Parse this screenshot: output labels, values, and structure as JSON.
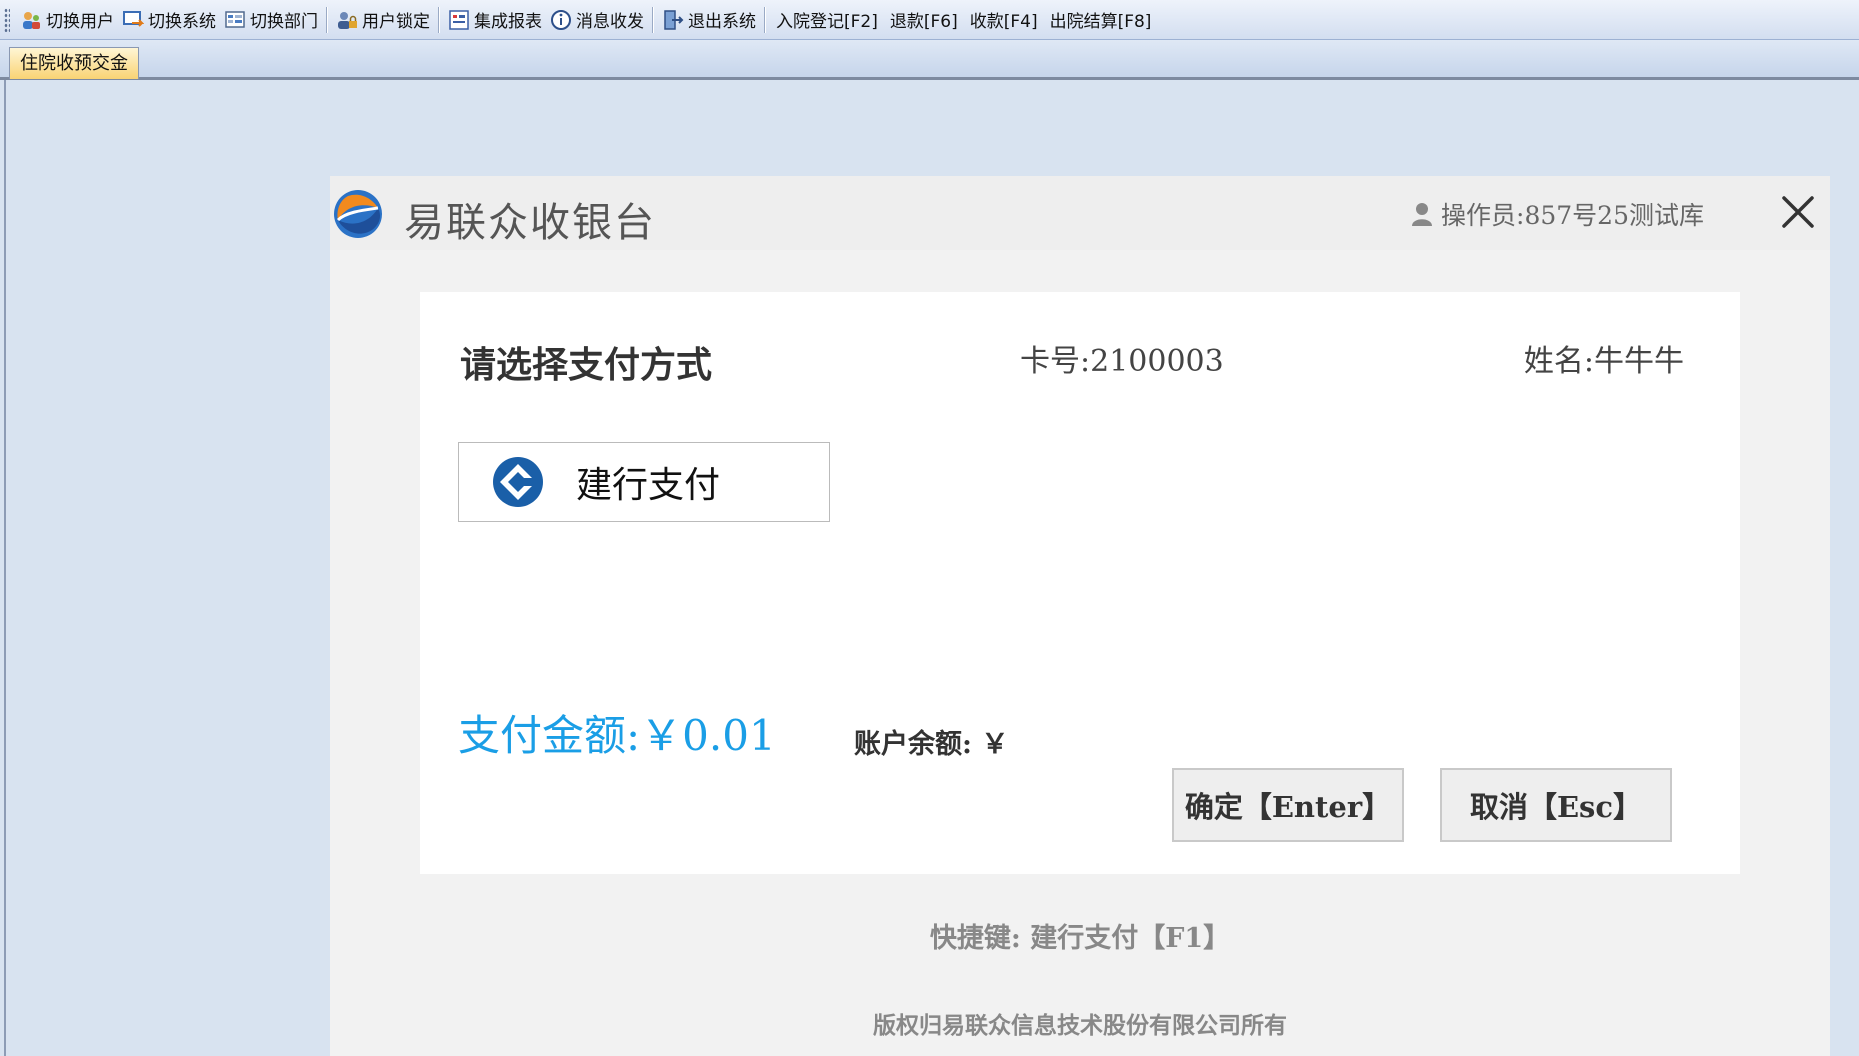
{
  "toolbar": {
    "items": [
      {
        "label": "切换用户",
        "icon": "switch-user-icon"
      },
      {
        "label": "切换系统",
        "icon": "switch-system-icon"
      },
      {
        "label": "切换部门",
        "icon": "switch-department-icon"
      },
      {
        "label": "用户锁定",
        "icon": "user-lock-icon"
      },
      {
        "label": "集成报表",
        "icon": "report-icon"
      },
      {
        "label": "消息收发",
        "icon": "message-icon"
      },
      {
        "label": "退出系统",
        "icon": "exit-icon"
      }
    ],
    "shortcuts": {
      "admit": "入院登记[F2]",
      "refund": "退款[F6]",
      "collect": "收款[F4]",
      "discharge": "出院结算[F8]"
    }
  },
  "tabs": {
    "active_label": "住院收预交金"
  },
  "dialog": {
    "title": "易联众收银台",
    "operator": "操作员:857号25测试库",
    "pick_title": "请选择支付方式",
    "card_no": "卡号:2100003",
    "patient_name": "姓名:牛牛牛",
    "pay_option_label": "建行支付",
    "amount": "支付金额:￥0.01",
    "balance": "账户余额: ￥",
    "confirm_button": "确定【Enter】",
    "cancel_button": "取消【Esc】",
    "shortcut_hint": "快捷键: 建行支付【F1】",
    "copyright": "版权归易联众信息技术股份有限公司所有"
  },
  "colors": {
    "accent_amount": "#1a9ee6",
    "ccb_blue": "#1a5fa8",
    "tab_active": "#f9d374"
  }
}
